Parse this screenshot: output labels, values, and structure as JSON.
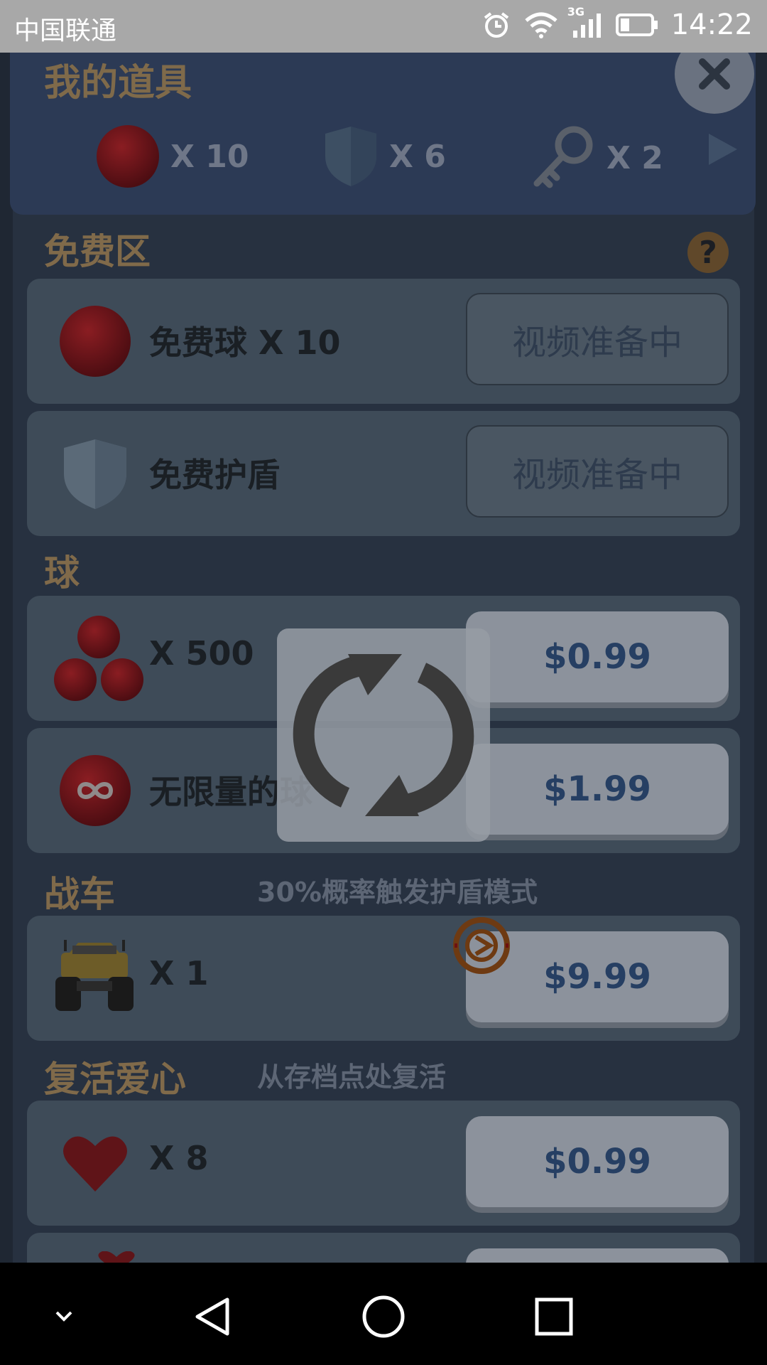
{
  "status_bar": {
    "carrier": "中国联通",
    "network": "3G",
    "time": "14:22"
  },
  "inventory": {
    "title": "我的道具",
    "items": [
      {
        "icon": "red-ball-icon",
        "count": "X 10"
      },
      {
        "icon": "shield-icon",
        "count": "X 6"
      },
      {
        "icon": "key-icon",
        "count": "X 2"
      }
    ]
  },
  "sections": {
    "free": {
      "title": "免费区",
      "help": "?"
    },
    "balls": {
      "title": "球"
    },
    "car": {
      "title": "战车",
      "note": "30%概率触发护盾模式"
    },
    "revive": {
      "title": "复活爱心",
      "note": "从存档点处复活"
    }
  },
  "cards": {
    "free_balls": {
      "label": "免费球 X 10",
      "button": "视频准备中"
    },
    "free_shield": {
      "label": "免费护盾",
      "button": "视频准备中"
    },
    "balls_500": {
      "label": "X 500",
      "price": "$0.99"
    },
    "unlimited_balls": {
      "label": "无限量的球",
      "price": "$1.99"
    },
    "car_1": {
      "label": "X 1",
      "price": "$9.99"
    },
    "hearts_8": {
      "label": "X 8",
      "price": "$0.99"
    }
  },
  "colors": {
    "overlay_dim": "#1d2430",
    "price_text": "#263f63",
    "section_title": "#806a4a"
  }
}
